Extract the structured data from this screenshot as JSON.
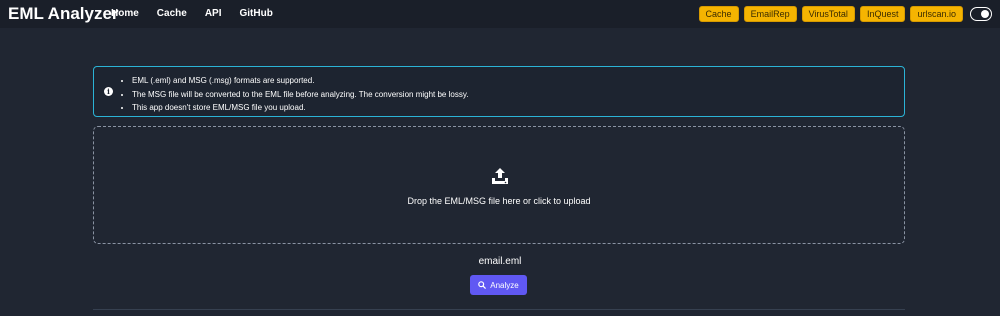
{
  "navbar": {
    "brand": "EML Analyzer",
    "links": [
      "Home",
      "Cache",
      "API",
      "GitHub"
    ],
    "badges": [
      "Cache",
      "EmailRep",
      "VirusTotal",
      "InQuest",
      "urlscan.io"
    ],
    "badge_color": "#f5b401"
  },
  "notice": {
    "icon": "info-icon",
    "items": [
      "EML (.eml) and MSG (.msg) formats are supported.",
      "The MSG file will be converted to the EML file before analyzing. The conversion might be lossy.",
      "This app doesn't store EML/MSG file you upload."
    ],
    "border_color": "#2bb3d6"
  },
  "dropzone": {
    "icon": "upload-icon",
    "text": "Drop the EML/MSG file here or click to upload"
  },
  "file": {
    "name": "email.eml"
  },
  "analyze": {
    "label": "Analyze",
    "icon": "search-icon",
    "color": "#6058f3"
  }
}
